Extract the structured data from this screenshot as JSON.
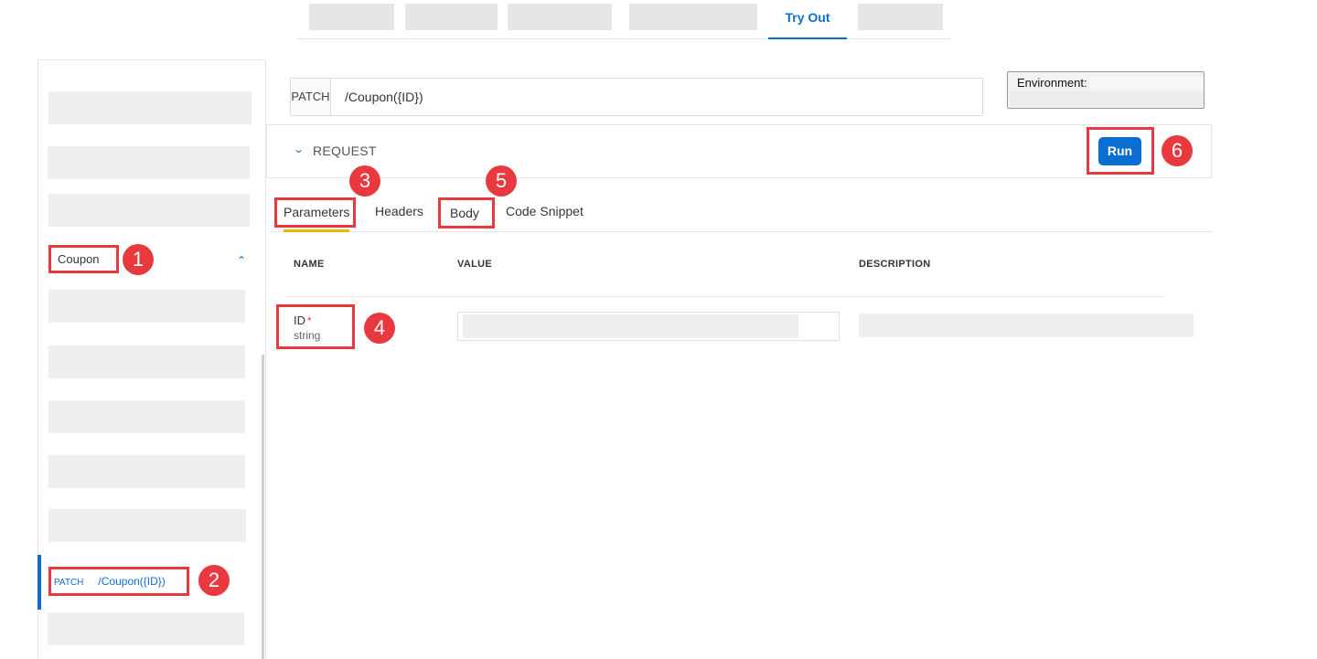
{
  "top_tabs": {
    "active_label": "Try Out"
  },
  "sidebar": {
    "group_label": "Coupon",
    "active_item": {
      "method": "PATCH",
      "path": "/Coupon({ID})"
    }
  },
  "url_bar": {
    "method": "PATCH",
    "path": "/Coupon({ID})"
  },
  "environment": {
    "label": "Environment:"
  },
  "request": {
    "label": "REQUEST",
    "run_label": "Run"
  },
  "sub_tabs": {
    "parameters": "Parameters",
    "headers": "Headers",
    "body": "Body",
    "code_snippet": "Code Snippet"
  },
  "table": {
    "headers": {
      "name": "NAME",
      "value": "VALUE",
      "description": "DESCRIPTION"
    },
    "rows": [
      {
        "name": "ID",
        "required_mark": "*",
        "type": "string"
      }
    ]
  },
  "annotations": {
    "b1": "1",
    "b2": "2",
    "b3": "3",
    "b4": "4",
    "b5": "5",
    "b6": "6"
  },
  "colors": {
    "accent": "#0a6ed1",
    "annotation": "#e8393e",
    "tab_underline": "#e9b600"
  }
}
